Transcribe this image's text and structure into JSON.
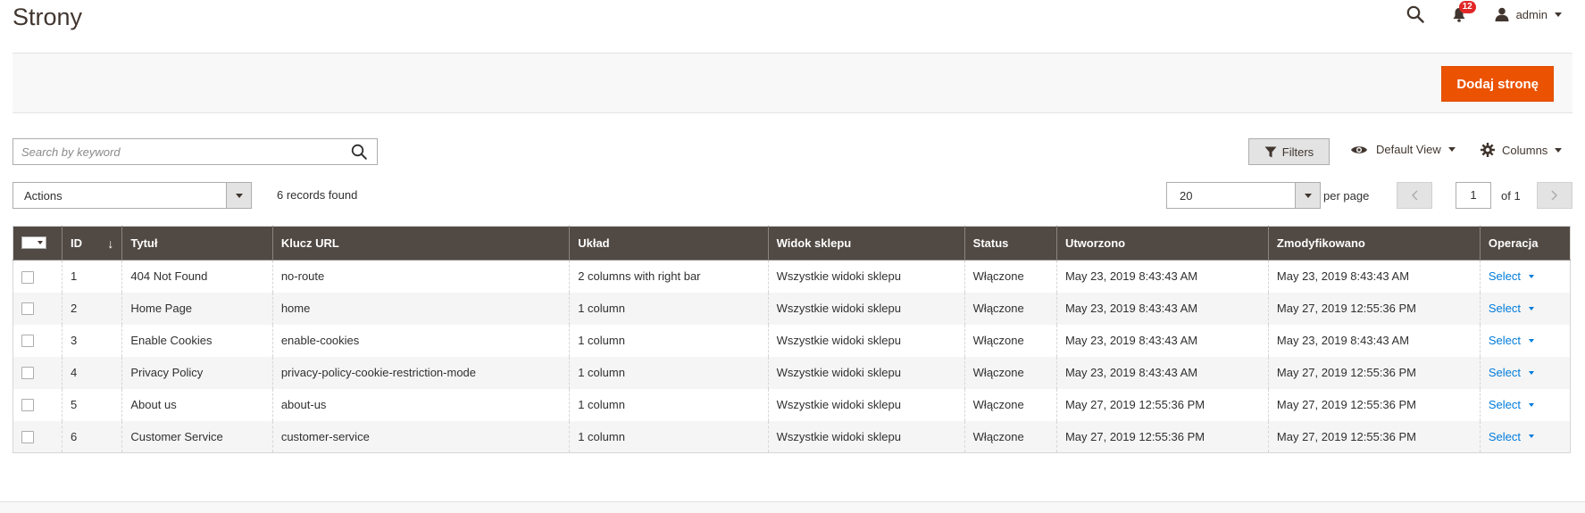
{
  "page": {
    "title": "Strony"
  },
  "header": {
    "notifications_count": "12",
    "user_name": "admin"
  },
  "action_bar": {
    "add_button_label": "Dodaj stronę"
  },
  "search": {
    "placeholder": "Search by keyword"
  },
  "toolbar": {
    "filters_label": "Filters",
    "view_label": "Default View",
    "columns_label": "Columns",
    "actions_label": "Actions",
    "records_found": "6 records found",
    "per_page_value": "20",
    "per_page_label": "per page",
    "current_page": "1",
    "total_pages_label": "of 1"
  },
  "table": {
    "columns": [
      "ID",
      "Tytuł",
      "Klucz URL",
      "Układ",
      "Widok sklepu",
      "Status",
      "Utworzono",
      "Zmodyfikowano",
      "Operacja"
    ],
    "rows": [
      {
        "id": "1",
        "title": "404 Not Found",
        "url_key": "no-route",
        "layout": "2 columns with right bar",
        "store_view": "Wszystkie widoki sklepu",
        "status": "Włączone",
        "created": "May 23, 2019 8:43:43 AM",
        "modified": "May 23, 2019 8:43:43 AM",
        "action": "Select"
      },
      {
        "id": "2",
        "title": "Home Page",
        "url_key": "home",
        "layout": "1 column",
        "store_view": "Wszystkie widoki sklepu",
        "status": "Włączone",
        "created": "May 23, 2019 8:43:43 AM",
        "modified": "May 27, 2019 12:55:36 PM",
        "action": "Select"
      },
      {
        "id": "3",
        "title": "Enable Cookies",
        "url_key": "enable-cookies",
        "layout": "1 column",
        "store_view": "Wszystkie widoki sklepu",
        "status": "Włączone",
        "created": "May 23, 2019 8:43:43 AM",
        "modified": "May 23, 2019 8:43:43 AM",
        "action": "Select"
      },
      {
        "id": "4",
        "title": "Privacy Policy",
        "url_key": "privacy-policy-cookie-restriction-mode",
        "layout": "1 column",
        "store_view": "Wszystkie widoki sklepu",
        "status": "Włączone",
        "created": "May 23, 2019 8:43:43 AM",
        "modified": "May 27, 2019 12:55:36 PM",
        "action": "Select"
      },
      {
        "id": "5",
        "title": "About us",
        "url_key": "about-us",
        "layout": "1 column",
        "store_view": "Wszystkie widoki sklepu",
        "status": "Włączone",
        "created": "May 27, 2019 12:55:36 PM",
        "modified": "May 27, 2019 12:55:36 PM",
        "action": "Select"
      },
      {
        "id": "6",
        "title": "Customer Service",
        "url_key": "customer-service",
        "layout": "1 column",
        "store_view": "Wszystkie widoki sklepu",
        "status": "Włączone",
        "created": "May 27, 2019 12:55:36 PM",
        "modified": "May 27, 2019 12:55:36 PM",
        "action": "Select"
      }
    ]
  },
  "colors": {
    "accent": "#eb5202",
    "header_bg": "#514943",
    "link": "#007bdb",
    "badge": "#e22626"
  }
}
